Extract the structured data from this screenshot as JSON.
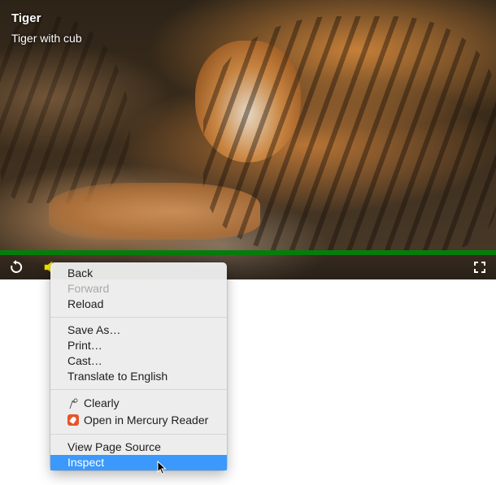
{
  "video": {
    "title": "Tiger",
    "subtitle": "Tiger with cub",
    "progress_fraction": 1.0,
    "progress_color": "#067d0a",
    "controls": {
      "replay_icon": "replay-icon",
      "volume_icon": "volume-icon",
      "volume_color": "#f5e600",
      "fullscreen_icon": "fullscreen-icon"
    }
  },
  "context_menu": {
    "group1": {
      "back": "Back",
      "forward": "Forward",
      "reload": "Reload"
    },
    "group2": {
      "save_as": "Save As…",
      "print": "Print…",
      "cast": "Cast…",
      "translate": "Translate to English"
    },
    "group3": {
      "clearly": "Clearly",
      "clearly_icon": "clearly-icon",
      "mercury": "Open in Mercury Reader",
      "mercury_icon": "mercury-rocket-icon"
    },
    "group4": {
      "view_source": "View Page Source",
      "inspect": "Inspect"
    },
    "highlight_color": "#3b99fc"
  }
}
